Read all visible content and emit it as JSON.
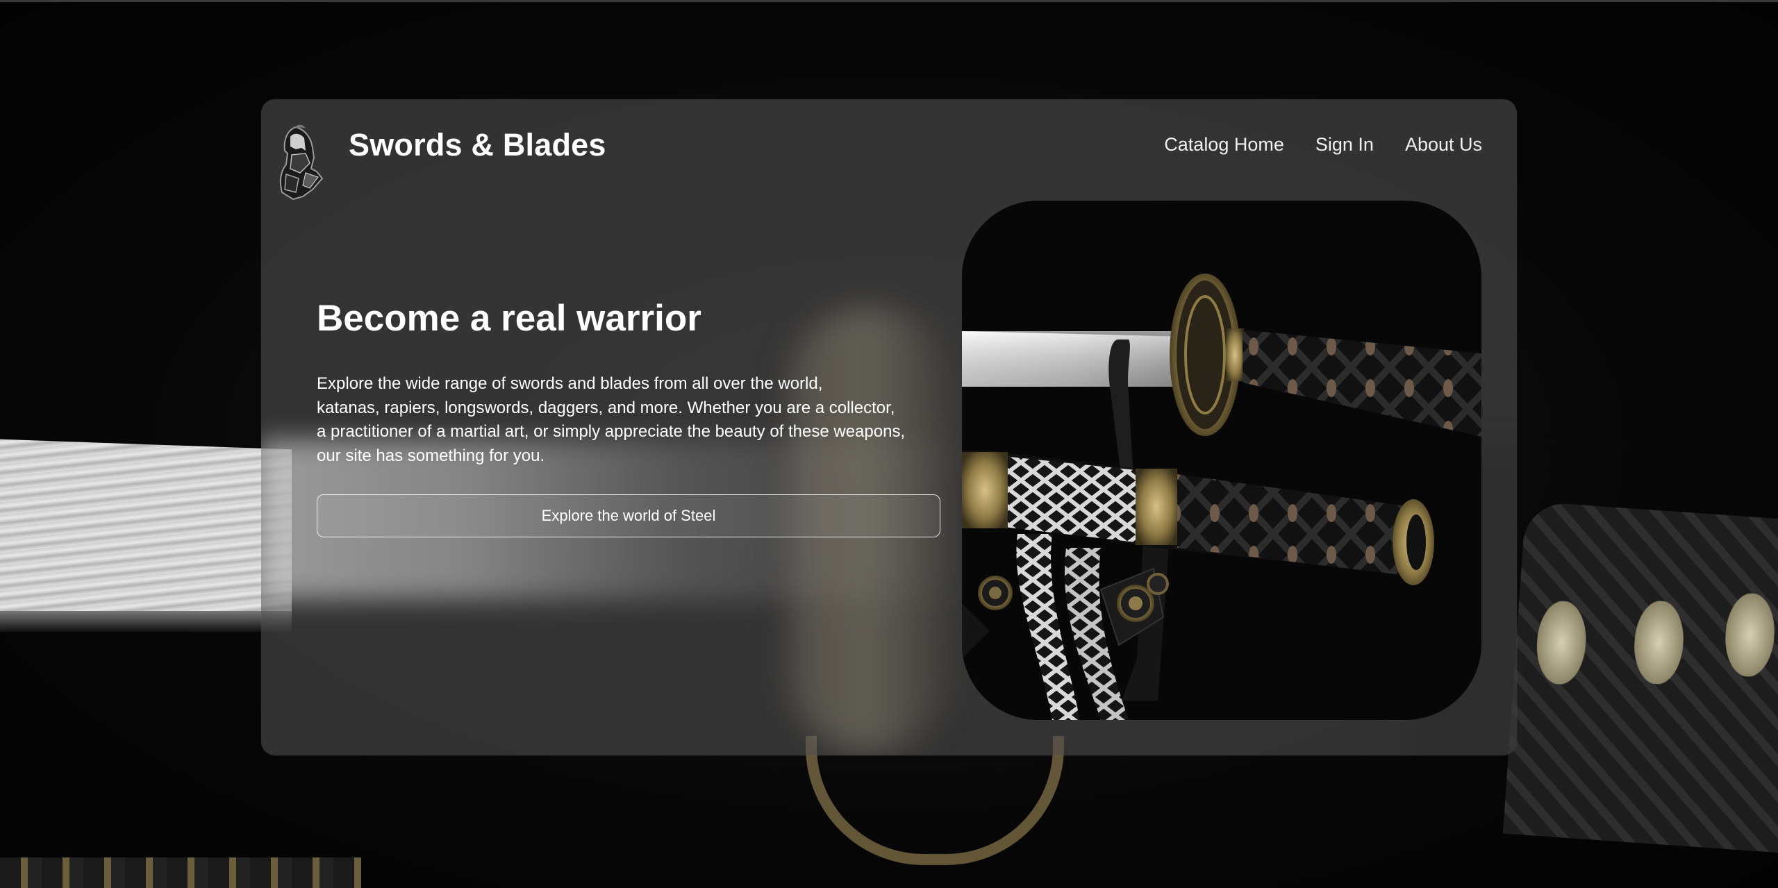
{
  "brand": {
    "name": "Swords & Blades",
    "logo_icon": "spartan-warrior-logo-icon"
  },
  "nav": {
    "items": [
      {
        "label": "Catalog Home"
      },
      {
        "label": "Sign In"
      },
      {
        "label": "About Us"
      }
    ]
  },
  "hero": {
    "title": "Become a real warrior",
    "lines": [
      "Explore the wide range of swords and blades from all over the world,",
      "katanas, rapiers, longswords, daggers, and more. Whether you are a collector,",
      "a practitioner of a martial art, or simply appreciate the beauty of these weapons,",
      "our site has something for you."
    ],
    "cta_label": "Explore the world of Steel",
    "image": "katana-display-photo"
  },
  "colors": {
    "background": "#050505",
    "card": "#4e4e4e",
    "text": "#ffffff",
    "brass": "#b49a5c"
  }
}
